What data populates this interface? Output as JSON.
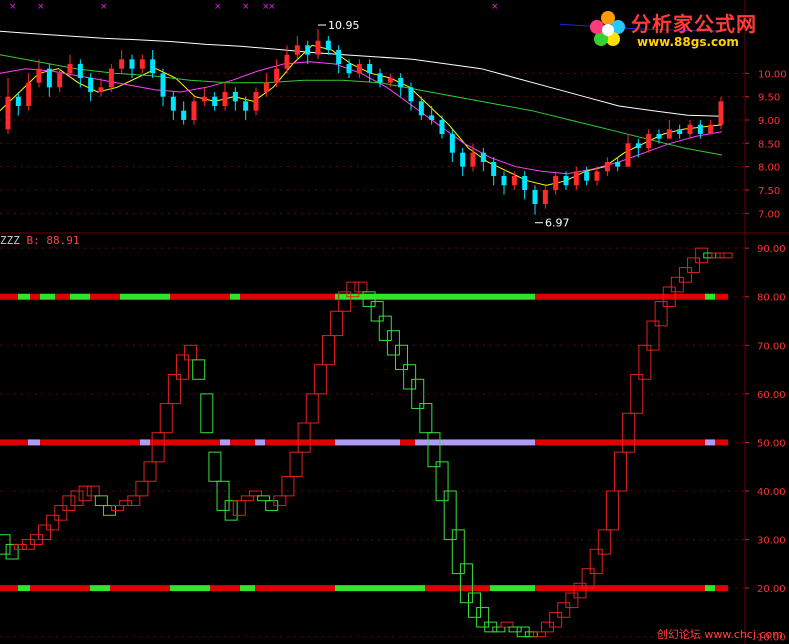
{
  "watermark": {
    "site_name": "分析家公式网",
    "site_url": "www.88gs.com",
    "footer": "创幻论坛 www.chcj.com"
  },
  "colors": {
    "up": "#ff2a2a",
    "down": "#00e5ff",
    "indicator_up": "#e02020",
    "indicator_down": "#37e23a",
    "band_red": "#e00000",
    "band_green": "#2ee52e",
    "band_lavender": "#b09cf2",
    "grid": "#6a0000"
  },
  "chart_data": [
    {
      "type": "candlestick",
      "ylim": [
        6.6,
        11.4
      ],
      "yticks": [
        "7.00",
        "7.50",
        "8.00",
        "8.50",
        "9.00",
        "9.50",
        "10.00"
      ],
      "grid": true,
      "annotations": [
        {
          "label": "10.95",
          "value": 10.95,
          "kind": "high"
        },
        {
          "label": "6.97",
          "value": 6.97,
          "kind": "low"
        }
      ],
      "candles": [
        [
          8.8,
          9.5,
          9.9,
          8.7
        ],
        [
          9.5,
          9.3,
          9.6,
          9.1
        ],
        [
          9.3,
          9.8,
          10.0,
          9.2
        ],
        [
          9.8,
          10.1,
          10.3,
          9.7
        ],
        [
          10.1,
          9.7,
          10.2,
          9.5
        ],
        [
          9.7,
          10.0,
          10.1,
          9.6
        ],
        [
          10.0,
          10.2,
          10.4,
          9.9
        ],
        [
          10.2,
          9.9,
          10.3,
          9.7
        ],
        [
          9.9,
          9.6,
          10.0,
          9.4
        ],
        [
          9.6,
          9.7,
          9.9,
          9.5
        ],
        [
          9.7,
          10.1,
          10.2,
          9.6
        ],
        [
          10.1,
          10.3,
          10.5,
          10.0
        ],
        [
          10.3,
          10.1,
          10.4,
          9.9
        ],
        [
          10.1,
          10.3,
          10.4,
          10.0
        ],
        [
          10.3,
          10.0,
          10.5,
          9.9
        ],
        [
          10.0,
          9.5,
          10.1,
          9.3
        ],
        [
          9.5,
          9.2,
          9.6,
          9.0
        ],
        [
          9.2,
          9.0,
          9.4,
          8.9
        ],
        [
          9.0,
          9.4,
          9.5,
          8.9
        ],
        [
          9.4,
          9.5,
          9.7,
          9.3
        ],
        [
          9.5,
          9.3,
          9.6,
          9.2
        ],
        [
          9.3,
          9.6,
          9.8,
          9.2
        ],
        [
          9.6,
          9.4,
          9.7,
          9.2
        ],
        [
          9.4,
          9.2,
          9.5,
          9.0
        ],
        [
          9.2,
          9.6,
          9.7,
          9.1
        ],
        [
          9.6,
          9.8,
          10.0,
          9.5
        ],
        [
          9.8,
          10.1,
          10.3,
          9.7
        ],
        [
          10.1,
          10.4,
          10.6,
          10.0
        ],
        [
          10.4,
          10.6,
          10.8,
          10.3
        ],
        [
          10.6,
          10.4,
          10.7,
          10.2
        ],
        [
          10.4,
          10.7,
          10.95,
          10.3
        ],
        [
          10.7,
          10.5,
          10.8,
          10.4
        ],
        [
          10.5,
          10.2,
          10.6,
          10.0
        ],
        [
          10.2,
          10.0,
          10.3,
          9.9
        ],
        [
          10.0,
          10.2,
          10.3,
          9.9
        ],
        [
          10.2,
          10.0,
          10.3,
          9.8
        ],
        [
          10.0,
          9.8,
          10.1,
          9.7
        ],
        [
          9.8,
          9.9,
          10.0,
          9.7
        ],
        [
          9.9,
          9.7,
          10.0,
          9.5
        ],
        [
          9.7,
          9.4,
          9.8,
          9.2
        ],
        [
          9.4,
          9.1,
          9.5,
          9.0
        ],
        [
          9.1,
          9.0,
          9.3,
          8.9
        ],
        [
          9.0,
          8.7,
          9.1,
          8.6
        ],
        [
          8.7,
          8.3,
          8.8,
          8.1
        ],
        [
          8.3,
          8.0,
          8.4,
          7.8
        ],
        [
          8.0,
          8.3,
          8.5,
          7.9
        ],
        [
          8.3,
          8.1,
          8.4,
          7.9
        ],
        [
          8.1,
          7.8,
          8.2,
          7.6
        ],
        [
          7.8,
          7.6,
          7.9,
          7.4
        ],
        [
          7.6,
          7.8,
          7.9,
          7.5
        ],
        [
          7.8,
          7.5,
          7.9,
          7.3
        ],
        [
          7.5,
          7.2,
          7.6,
          6.97
        ],
        [
          7.2,
          7.5,
          7.6,
          7.1
        ],
        [
          7.5,
          7.8,
          7.9,
          7.4
        ],
        [
          7.8,
          7.6,
          7.9,
          7.5
        ],
        [
          7.6,
          7.9,
          8.0,
          7.5
        ],
        [
          7.9,
          7.7,
          8.0,
          7.6
        ],
        [
          7.7,
          7.9,
          8.0,
          7.6
        ],
        [
          7.9,
          8.1,
          8.2,
          7.8
        ],
        [
          8.1,
          8.0,
          8.2,
          7.9
        ],
        [
          8.0,
          8.5,
          8.7,
          8.0
        ],
        [
          8.5,
          8.4,
          8.6,
          8.2
        ],
        [
          8.4,
          8.7,
          8.8,
          8.3
        ],
        [
          8.7,
          8.6,
          8.8,
          8.5
        ],
        [
          8.6,
          8.8,
          9.0,
          8.6
        ],
        [
          8.8,
          8.7,
          8.9,
          8.6
        ],
        [
          8.7,
          8.9,
          9.0,
          8.6
        ],
        [
          8.9,
          8.7,
          9.0,
          8.6
        ],
        [
          8.7,
          8.9,
          9.0,
          8.7
        ],
        [
          8.9,
          9.4,
          9.5,
          8.8
        ]
      ],
      "ma_series": [
        {
          "color": "#ffffff",
          "values": [
            10.9,
            10.85,
            10.8,
            10.75,
            10.72,
            10.68,
            10.62,
            10.58,
            10.52,
            10.45,
            10.4,
            10.35,
            10.3,
            10.2,
            10.1,
            9.9,
            9.7,
            9.5,
            9.3,
            9.2,
            9.1,
            9.08
          ]
        },
        {
          "color": "#ffff00",
          "values": [
            9.2,
            9.6,
            10.0,
            10.1,
            9.8,
            9.6,
            9.7,
            9.9,
            10.1,
            9.9,
            9.5,
            9.4,
            9.5,
            9.4,
            9.7,
            10.2,
            10.6,
            10.5,
            10.2,
            10.0,
            9.9,
            9.7,
            9.3,
            8.9,
            8.4,
            8.1,
            7.9,
            7.7,
            7.6,
            7.7,
            7.9,
            8.0,
            8.3,
            8.5,
            8.7,
            8.8,
            8.85,
            8.9
          ]
        },
        {
          "color": "#ff40ff",
          "values": [
            10.0,
            10.1,
            10.05,
            9.95,
            9.85,
            9.75,
            9.65,
            9.6,
            9.7,
            9.85,
            10.05,
            10.2,
            10.25,
            10.2,
            10.0,
            9.7,
            9.3,
            8.9,
            8.5,
            8.2,
            8.0,
            7.9,
            7.85,
            7.95,
            8.1,
            8.3,
            8.5,
            8.65,
            8.75
          ]
        },
        {
          "color": "#33cc33",
          "values": [
            10.4,
            10.25,
            10.1,
            10.0,
            9.95,
            9.85,
            9.8,
            9.8,
            9.85,
            9.85,
            9.8,
            9.65,
            9.5,
            9.35,
            9.2,
            9.0,
            8.8,
            8.6,
            8.4,
            8.25
          ]
        },
        {
          "color": "#2222dd",
          "values": [
            11.05,
            11.0,
            10.95,
            10.92,
            10.9
          ]
        }
      ]
    },
    {
      "type": "indicator",
      "indicator_name": "ZZZ",
      "indicator_value_label": "B: 88.91",
      "ylim": [
        8.5,
        92.5
      ],
      "yticks": [
        "10.00",
        "20.00",
        "30.00",
        "40.00",
        "50.00",
        "60.00",
        "70.00",
        "80.00",
        "90.00"
      ],
      "grid": true,
      "boxes": [
        [
          31,
          27,
          "g"
        ],
        [
          29,
          26,
          "g"
        ],
        [
          29,
          28,
          "r"
        ],
        [
          30,
          28,
          "r"
        ],
        [
          31,
          29,
          "r"
        ],
        [
          33,
          30,
          "r"
        ],
        [
          35,
          32,
          "r"
        ],
        [
          37,
          34,
          "r"
        ],
        [
          39,
          36,
          "r"
        ],
        [
          40,
          37,
          "r"
        ],
        [
          41,
          38,
          "r"
        ],
        [
          41,
          39,
          "r"
        ],
        [
          39,
          37,
          "g"
        ],
        [
          37,
          35,
          "g"
        ],
        [
          36,
          37,
          "r"
        ],
        [
          37,
          38,
          "r"
        ],
        [
          37,
          39,
          "r"
        ],
        [
          39,
          42,
          "r"
        ],
        [
          42,
          46,
          "r"
        ],
        [
          46,
          52,
          "r"
        ],
        [
          52,
          58,
          "r"
        ],
        [
          58,
          64,
          "r"
        ],
        [
          63,
          68,
          "r"
        ],
        [
          67,
          70,
          "r"
        ],
        [
          67,
          63,
          "g"
        ],
        [
          60,
          52,
          "g"
        ],
        [
          48,
          42,
          "g"
        ],
        [
          42,
          36,
          "g"
        ],
        [
          38,
          34,
          "g"
        ],
        [
          35,
          38,
          "r"
        ],
        [
          38,
          39,
          "r"
        ],
        [
          40,
          39,
          "r"
        ],
        [
          39,
          38,
          "g"
        ],
        [
          38,
          36,
          "g"
        ],
        [
          37,
          39,
          "r"
        ],
        [
          39,
          43,
          "r"
        ],
        [
          43,
          48,
          "r"
        ],
        [
          48,
          54,
          "r"
        ],
        [
          54,
          60,
          "r"
        ],
        [
          60,
          66,
          "r"
        ],
        [
          66,
          72,
          "r"
        ],
        [
          72,
          77,
          "r"
        ],
        [
          77,
          81,
          "r"
        ],
        [
          80,
          83,
          "r"
        ],
        [
          81,
          83,
          "r"
        ],
        [
          81,
          78,
          "g"
        ],
        [
          79,
          75,
          "g"
        ],
        [
          76,
          71,
          "g"
        ],
        [
          73,
          68,
          "g"
        ],
        [
          70,
          65,
          "g"
        ],
        [
          66,
          61,
          "g"
        ],
        [
          63,
          57,
          "g"
        ],
        [
          58,
          52,
          "g"
        ],
        [
          52,
          45,
          "g"
        ],
        [
          46,
          38,
          "g"
        ],
        [
          40,
          30,
          "g"
        ],
        [
          32,
          23,
          "g"
        ],
        [
          25,
          17,
          "g"
        ],
        [
          19,
          14,
          "g"
        ],
        [
          16,
          12,
          "g"
        ],
        [
          13,
          11,
          "g"
        ],
        [
          12,
          11,
          "g"
        ],
        [
          13,
          12,
          "r"
        ],
        [
          12,
          11,
          "g"
        ],
        [
          12,
          10,
          "g"
        ],
        [
          11,
          10,
          "g"
        ],
        [
          10,
          11,
          "r"
        ],
        [
          11,
          13,
          "r"
        ],
        [
          12,
          15,
          "r"
        ],
        [
          14,
          17,
          "r"
        ],
        [
          16,
          19,
          "r"
        ],
        [
          18,
          21,
          "r"
        ],
        [
          20,
          24,
          "r"
        ],
        [
          23,
          28,
          "r"
        ],
        [
          27,
          32,
          "r"
        ],
        [
          32,
          40,
          "r"
        ],
        [
          40,
          48,
          "r"
        ],
        [
          48,
          56,
          "r"
        ],
        [
          56,
          64,
          "r"
        ],
        [
          63,
          70,
          "r"
        ],
        [
          69,
          75,
          "r"
        ],
        [
          74,
          79,
          "r"
        ],
        [
          78,
          82,
          "r"
        ],
        [
          81,
          84,
          "r"
        ],
        [
          83,
          86,
          "r"
        ],
        [
          85,
          88,
          "r"
        ],
        [
          87,
          90,
          "r"
        ],
        [
          89,
          88,
          "g"
        ],
        [
          88,
          89,
          "r"
        ],
        [
          88,
          89,
          "r"
        ]
      ],
      "bands": [
        {
          "level": 80,
          "segments": [
            [
              0,
              18,
              "r"
            ],
            [
              18,
              30,
              "g"
            ],
            [
              30,
              40,
              "r"
            ],
            [
              40,
              55,
              "g"
            ],
            [
              55,
              70,
              "r"
            ],
            [
              70,
              90,
              "g"
            ],
            [
              90,
              120,
              "r"
            ],
            [
              120,
              170,
              "g"
            ],
            [
              170,
              205,
              "r"
            ],
            [
              205,
              230,
              "r"
            ],
            [
              230,
              240,
              "g"
            ],
            [
              240,
              290,
              "r"
            ],
            [
              290,
              335,
              "r"
            ],
            [
              335,
              490,
              "g"
            ],
            [
              490,
              535,
              "g"
            ],
            [
              535,
              705,
              "r"
            ],
            [
              705,
              715,
              "g"
            ],
            [
              715,
              728,
              "r"
            ]
          ]
        },
        {
          "level": 50,
          "segments": [
            [
              0,
              28,
              "r"
            ],
            [
              28,
              40,
              "l"
            ],
            [
              40,
              140,
              "r"
            ],
            [
              140,
              150,
              "l"
            ],
            [
              150,
              220,
              "r"
            ],
            [
              220,
              230,
              "l"
            ],
            [
              230,
              255,
              "r"
            ],
            [
              255,
              265,
              "l"
            ],
            [
              265,
              335,
              "r"
            ],
            [
              335,
              400,
              "l"
            ],
            [
              400,
              415,
              "r"
            ],
            [
              415,
              535,
              "l"
            ],
            [
              535,
              705,
              "r"
            ],
            [
              705,
              715,
              "l"
            ],
            [
              715,
              728,
              "r"
            ]
          ]
        },
        {
          "level": 20,
          "segments": [
            [
              0,
              18,
              "r"
            ],
            [
              18,
              30,
              "g"
            ],
            [
              30,
              40,
              "r"
            ],
            [
              40,
              90,
              "r"
            ],
            [
              90,
              110,
              "g"
            ],
            [
              110,
              170,
              "r"
            ],
            [
              170,
              210,
              "g"
            ],
            [
              210,
              240,
              "r"
            ],
            [
              240,
              255,
              "g"
            ],
            [
              255,
              335,
              "r"
            ],
            [
              335,
              425,
              "g"
            ],
            [
              425,
              490,
              "r"
            ],
            [
              490,
              535,
              "g"
            ],
            [
              535,
              705,
              "r"
            ],
            [
              705,
              715,
              "g"
            ],
            [
              715,
              728,
              "r"
            ]
          ]
        }
      ]
    }
  ]
}
